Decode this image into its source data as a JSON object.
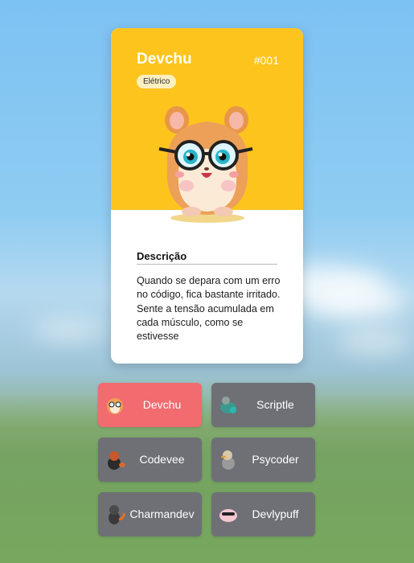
{
  "card": {
    "name": "Devchu",
    "number": "#001",
    "type": "Elétrico",
    "description_title": "Descrição",
    "description": "Quando se depara com um erro no código, fica bastante irritado. Sente a tensão acumulada em cada músculo, como se estivesse",
    "accent_color": "#fdc41e"
  },
  "selector": {
    "items": [
      {
        "label": "Devchu",
        "icon": "hamster-icon",
        "active": true
      },
      {
        "label": "Scriptle",
        "icon": "turtle-icon",
        "active": false
      },
      {
        "label": "Codevee",
        "icon": "fox-icon",
        "active": false
      },
      {
        "label": "Psycoder",
        "icon": "duck-icon",
        "active": false
      },
      {
        "label": "Charmandev",
        "icon": "lizard-icon",
        "active": false
      },
      {
        "label": "Devlypuff",
        "icon": "puff-icon",
        "active": false
      }
    ],
    "active_color": "#f26b6f",
    "inactive_color": "#6e7076"
  }
}
